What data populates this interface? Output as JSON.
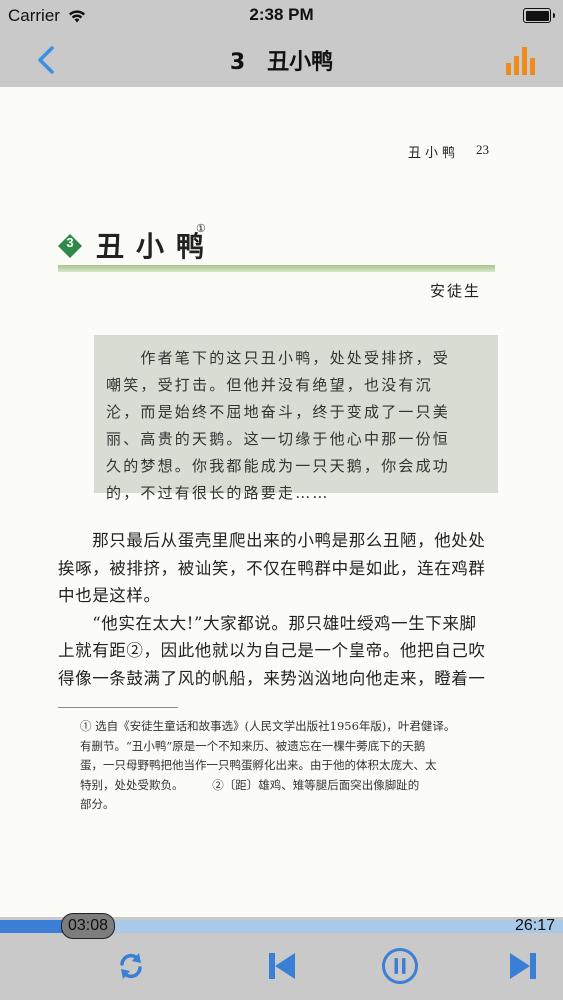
{
  "status_bar": {
    "carrier": "Carrier",
    "time": "2:38 PM"
  },
  "nav": {
    "title": "3 丑小鸭"
  },
  "page": {
    "running_head": "丑小鸭",
    "page_number": "23",
    "lesson_number": "3",
    "lesson_title": "丑小鸭",
    "title_footnote_mark": "①",
    "author": "安徒生",
    "intro_lines": [
      "　　作者笔下的这只丑小鸭，处处受排挤，受",
      "嘲笑，受打击。但他并没有绝望，也没有沉",
      "沦，而是始终不屈地奋斗，终于变成了一只美",
      "丽、高贵的天鹅。这一切缘于他心中那一份恒",
      "久的梦想。你我都能成为一只天鹅，你会成功",
      "的，不过有很长的路要走……"
    ],
    "body_lines": [
      "　　那只最后从蛋壳里爬出来的小鸭是那么丑陋，他处处",
      "挨啄，被排挤，被讪笑，不仅在鸭群中是如此，连在鸡群",
      "中也是这样。",
      "　　“他实在太大!”大家都说。那只雄吐绶鸡一生下来脚",
      "上就有距②，因此他就以为自己是一个皇帝。他把自己吹",
      "得像一条鼓满了风的帆船，来势汹汹地向他走来，瞪着一"
    ],
    "footnote_lines": [
      "① 选自《安徒生童话和故事选》(人民文学出版社1956年版)，叶君健译。",
      "有删节。“丑小鸭”原是一个不知来历、被遗忘在一棵牛蒡底下的天鹅",
      "蛋，一只母野鸭把他当作一只鸭蛋孵化出来。由于他的体积太庞大、太",
      "特别，处处受欺负。　　　②〔距〕雄鸡、雉等腿后面突出像脚趾的",
      "部分。"
    ]
  },
  "player": {
    "elapsed": "03:08",
    "duration": "26:17",
    "progress_fraction": 0.119,
    "colors": {
      "accent": "#3a7fd5",
      "track": "#a9c9e8",
      "chart_icon": "#f08a1c",
      "back_arrow": "#3a8fe0"
    },
    "icons": [
      "repeat-icon",
      "skip-previous-icon",
      "pause-icon",
      "skip-next-icon"
    ]
  }
}
